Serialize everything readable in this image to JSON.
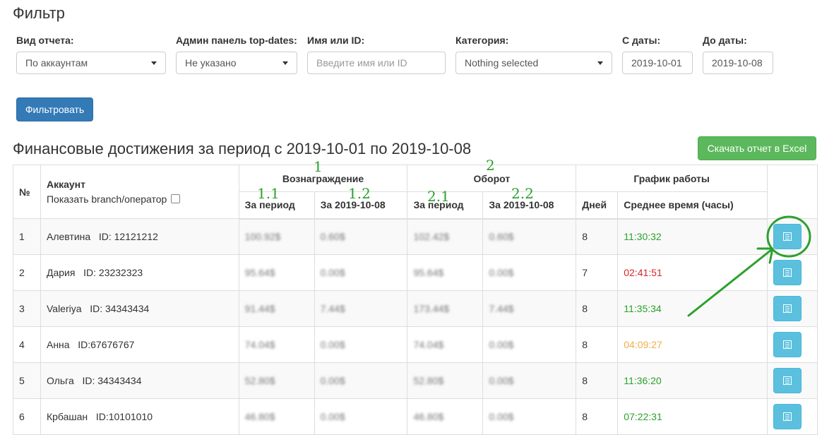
{
  "filter": {
    "title": "Фильтр",
    "report_type": {
      "label": "Вид отчета:",
      "value": "По аккаунтам"
    },
    "admin_panel": {
      "label": "Админ панель top-dates:",
      "value": "Не указано"
    },
    "name_or_id": {
      "label": "Имя или ID:",
      "placeholder": "Введите имя или ID"
    },
    "category": {
      "label": "Категория:",
      "value": "Nothing selected"
    },
    "date_from": {
      "label": "С даты:",
      "value": "2019-10-01"
    },
    "date_to": {
      "label": "До даты:",
      "value": "2019-10-08"
    },
    "submit_label": "Фильтровать"
  },
  "report": {
    "title": "Финансовые достижения за период с 2019-10-01 по 2019-10-08",
    "excel_label": "Скачать отчет в Excel",
    "headers": {
      "num": "№",
      "account": "Аккаунт",
      "show_branch": "Показать branch/оператор",
      "reward": "Вознаграждение",
      "turnover": "Оборот",
      "schedule": "График работы",
      "for_period": "За период",
      "for_date": "За 2019-10-08",
      "days": "Дней",
      "avg_time": "Среднее время (часы)"
    },
    "rows": [
      {
        "num": "1",
        "name": "Алевтина",
        "id": "ID: 12121212",
        "reward_period": "100.92$",
        "reward_date": "0.60$",
        "turnover_period": "102.42$",
        "turnover_date": "0.60$",
        "days": "8",
        "avg_time": "11:30:32",
        "time_status": "green"
      },
      {
        "num": "2",
        "name": "Дария",
        "id": "ID: 23232323",
        "reward_period": "95.64$",
        "reward_date": "0.00$",
        "turnover_period": "95.64$",
        "turnover_date": "0.00$",
        "days": "7",
        "avg_time": "02:41:51",
        "time_status": "red"
      },
      {
        "num": "3",
        "name": "Valeriya",
        "id": "ID: 34343434",
        "reward_period": "91.44$",
        "reward_date": "7.44$",
        "turnover_period": "173.44$",
        "turnover_date": "7.44$",
        "days": "8",
        "avg_time": "11:35:34",
        "time_status": "green"
      },
      {
        "num": "4",
        "name": "Анна",
        "id": "ID:67676767",
        "reward_period": "74.04$",
        "reward_date": "0.00$",
        "turnover_period": "74.04$",
        "turnover_date": "0.00$",
        "days": "8",
        "avg_time": "04:09:27",
        "time_status": "orange"
      },
      {
        "num": "5",
        "name": "Ольга",
        "id": "ID: 34343434",
        "reward_period": "52.80$",
        "reward_date": "0.00$",
        "turnover_period": "52.80$",
        "turnover_date": "0.00$",
        "days": "8",
        "avg_time": "11:36:20",
        "time_status": "green"
      },
      {
        "num": "6",
        "name": "Крбашан",
        "id": "ID:10101010",
        "reward_period": "46.80$",
        "reward_date": "0.00$",
        "turnover_period": "46.80$",
        "turnover_date": "0.00$",
        "days": "8",
        "avg_time": "07:22:31",
        "time_status": "green"
      }
    ]
  },
  "annotations": {
    "reward_group": "1",
    "reward_period": "1.1",
    "reward_date": "1.2",
    "turnover_group": "2",
    "turnover_period": "2.1",
    "turnover_date": "2.2",
    "color": "#2ca02c"
  },
  "colors": {
    "primary": "#337ab7",
    "success": "#5cb85c",
    "info": "#5bc0de",
    "status_green": "#2ca02c",
    "status_red": "#d62728",
    "status_orange": "#f0ad4e"
  }
}
